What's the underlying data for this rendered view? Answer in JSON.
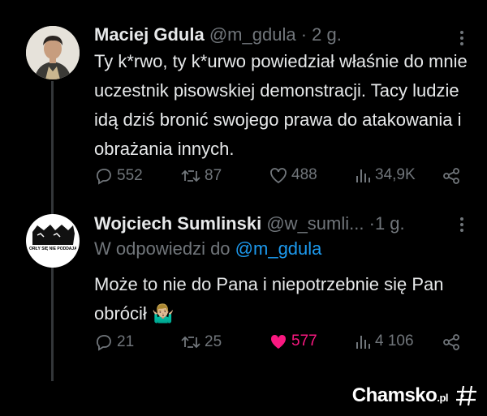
{
  "tweets": [
    {
      "name": "Maciej Gdula",
      "handle": "@m_gdula",
      "dot": "·",
      "time": "2 g.",
      "text": "Ty k*rwo, ty k*urwo powiedział właśnie do mnie uczestnik pisowskiej demonstracji. Tacy ludzie idą dziś bronić swojego prawa do atakowania i obrażania innych.",
      "replies": "552",
      "retweets": "87",
      "likes": "488",
      "views": "34,9K",
      "liked": false
    },
    {
      "name": "Wojciech Sumlinski",
      "handle": "@w_sumli...",
      "dot": "·",
      "time": "1 g.",
      "reply_prefix": "W odpowiedzi do",
      "reply_mention": "@m_gdula",
      "text": "Może to nie do Pana i niepotrzebnie się Pan obrócił",
      "emoji": "🤷🏼‍♂️",
      "avatar_text": "ORŁY SIĘ NIE PODDAJĄ",
      "replies": "21",
      "retweets": "25",
      "likes": "577",
      "views": "4 106",
      "liked": true
    }
  ],
  "watermark": {
    "text": "Chamsko",
    "suffix": ".pl"
  },
  "colors": {
    "background": "#000000",
    "text": "#e7e9ea",
    "muted": "#71767b",
    "link": "#1d9bf0",
    "like": "#f91880"
  },
  "icons": [
    "more-icon",
    "reply-icon",
    "retweet-icon",
    "like-icon",
    "views-icon",
    "share-icon",
    "hashtag-logo-icon"
  ]
}
